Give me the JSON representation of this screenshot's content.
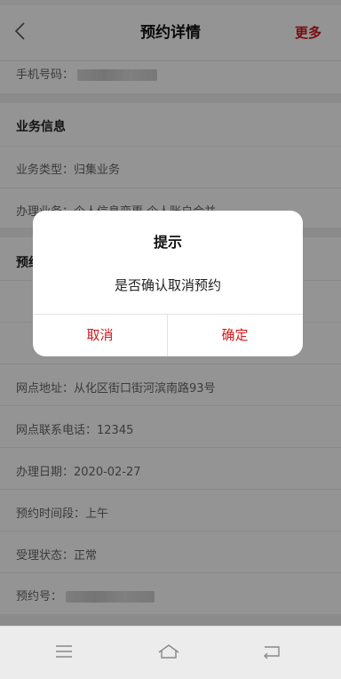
{
  "navbar": {
    "title": "预约详情",
    "more_label": "更多"
  },
  "rows": {
    "phone_label": "手机号码：",
    "business_section_title": "业务信息",
    "business_type": "业务类型：归集业务",
    "handle_business": "办理业务：个人信息变更,个人账户合并",
    "reservation_section_title": "预约信息",
    "outlet_address": "网点地址：从化区街口街河滨南路93号",
    "outlet_phone": "网点联系电话：12345",
    "handle_date": "办理日期：2020-02-27",
    "time_slot": "预约时间段：上午",
    "accept_status": "受理状态：正常",
    "reservation_no_label": "预约号："
  },
  "dialog": {
    "title": "提示",
    "message": "是否确认取消预约",
    "cancel_label": "取消",
    "confirm_label": "确定"
  },
  "colors": {
    "accent": "#d1181a",
    "background": "#f4f4f4"
  },
  "icons": {
    "back": "chevron-left-icon",
    "menu": "menu-icon",
    "home": "home-icon",
    "return": "return-icon"
  }
}
